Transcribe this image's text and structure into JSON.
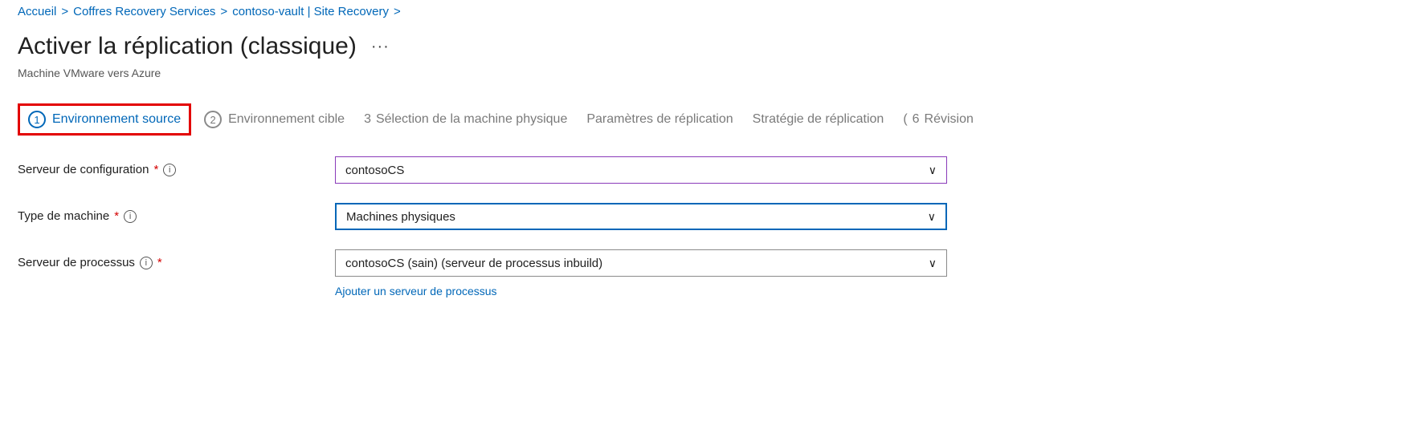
{
  "breadcrumb": [
    {
      "label": "Accueil"
    },
    {
      "label": "Coffres Recovery Services"
    },
    {
      "label": "contoso-vault | Site Recovery"
    }
  ],
  "page": {
    "title": "Activer la réplication (classique)",
    "ellipsis": "···",
    "subtitle": "Machine VMware vers Azure"
  },
  "steps": [
    {
      "num": "1",
      "label": "Environnement source"
    },
    {
      "num": "2",
      "label": "Environnement cible"
    },
    {
      "num": "3",
      "label": "Sélection de la machine physique"
    },
    {
      "num": "",
      "label": "Paramètres de réplication"
    },
    {
      "num": "",
      "label": "Stratégie de réplication"
    },
    {
      "num": "6",
      "label": "Révision"
    }
  ],
  "form": {
    "configServer": {
      "label": "Serveur de configuration",
      "required": "*",
      "value": "contosoCS"
    },
    "machineType": {
      "label": "Type de machine",
      "required": "*",
      "value": "Machines physiques"
    },
    "processServer": {
      "label": "Serveur de processus",
      "required": "*",
      "value": "contosoCS (sain) (serveur de processus inbuild)",
      "addLink": "Ajouter un serveur de processus"
    }
  }
}
